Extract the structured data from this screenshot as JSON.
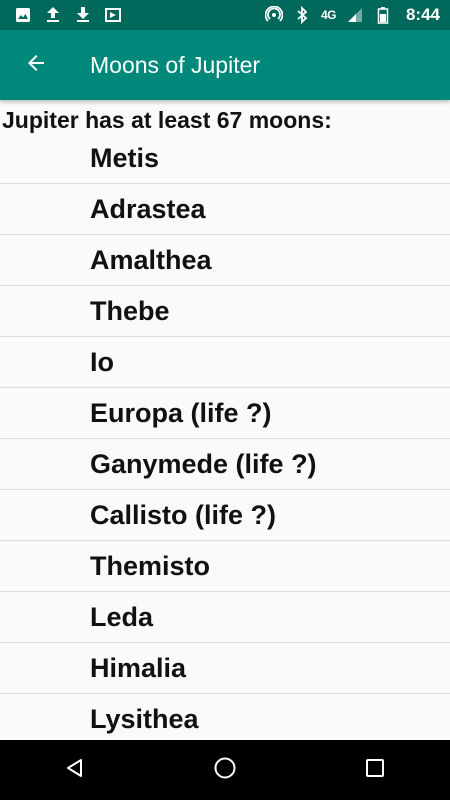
{
  "status_bar": {
    "time": "8:44",
    "network": "4G",
    "left_icons": [
      "image-icon",
      "upload-icon",
      "download-icon",
      "play-store-icon"
    ],
    "right_icons": [
      "hotspot-icon",
      "bluetooth-icon",
      "signal-icon",
      "battery-icon"
    ]
  },
  "app_bar": {
    "title": "Moons of Jupiter",
    "back_icon": "arrow-back-icon"
  },
  "content": {
    "heading": "Jupiter has at least 67 moons:",
    "moons": [
      "Metis",
      "Adrastea",
      "Amalthea",
      "Thebe",
      "Io",
      "Europa (life ?)",
      "Ganymede (life ?)",
      "Callisto (life ?)",
      "Themisto",
      "Leda",
      "Himalia",
      "Lysithea"
    ]
  },
  "nav_bar": {
    "buttons": [
      "back-triangle-icon",
      "home-circle-icon",
      "recents-square-icon"
    ]
  },
  "colors": {
    "status_bar": "#00695c",
    "app_bar": "#00897b",
    "background": "#fafafa",
    "nav_bar": "#000000"
  }
}
